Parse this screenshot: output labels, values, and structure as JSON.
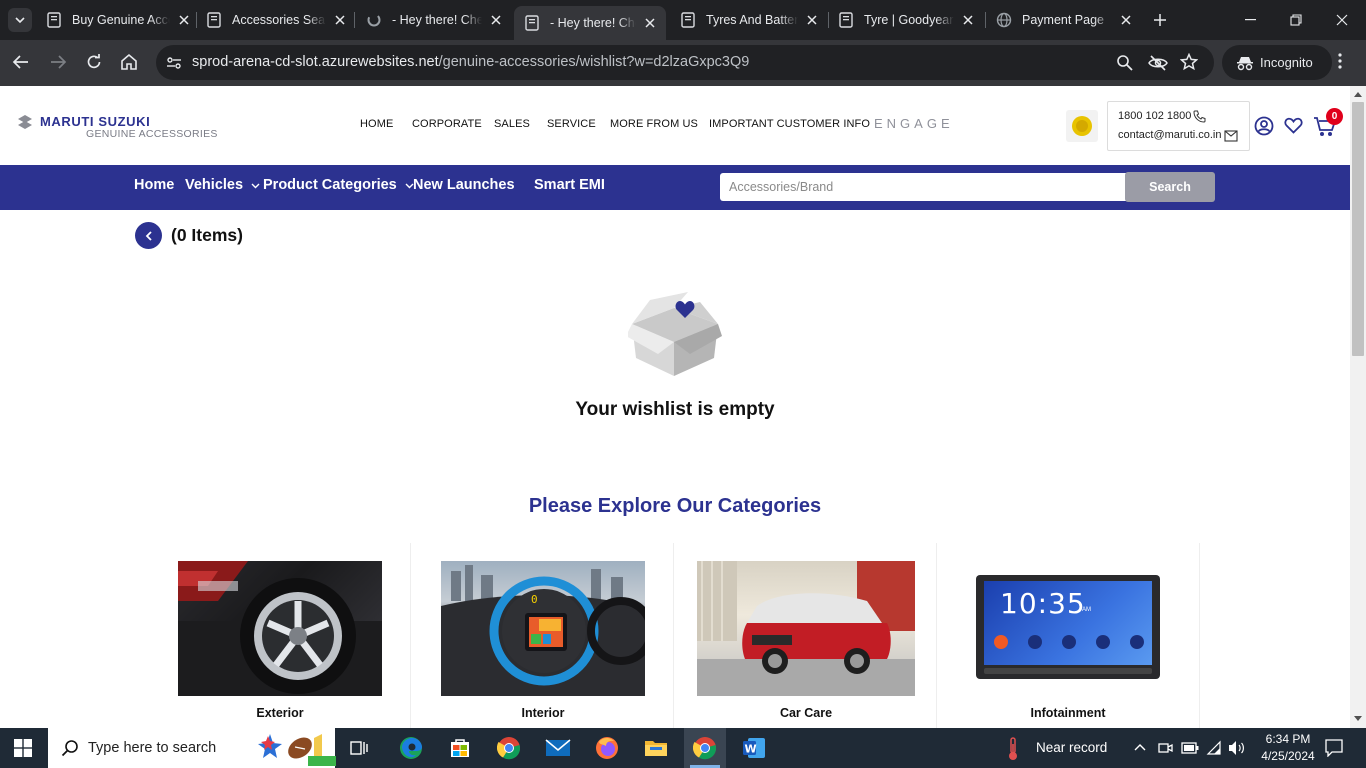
{
  "browser": {
    "tabs": [
      {
        "title": "Buy Genuine Accessories",
        "active": false
      },
      {
        "title": "Accessories Search",
        "active": false
      },
      {
        "title": "- Hey there! Check",
        "active": false
      },
      {
        "title": "- Hey there! Check",
        "active": true
      },
      {
        "title": "Tyres And Batteries",
        "active": false
      },
      {
        "title": "Tyre | Goodyear",
        "active": false
      },
      {
        "title": "Payment Page",
        "active": false
      }
    ],
    "url_host": "sprod-arena-cd-slot.azurewebsites.net",
    "url_path": "/genuine-accessories/wishlist?w=d2lzaGxpc3Q9",
    "incognito_label": "Incognito"
  },
  "header": {
    "brand": "MARUTI SUZUKI",
    "brand_sub": "GENUINE ACCESSORIES",
    "nav": [
      "HOME",
      "CORPORATE",
      "SALES",
      "SERVICE",
      "MORE FROM US",
      "IMPORTANT CUSTOMER INFO"
    ],
    "engage": "ENGAGE",
    "phone": "1800 102 1800",
    "email": "contact@maruti.co.in",
    "cart_count": "0"
  },
  "bluenav": {
    "items": [
      "Home",
      "Vehicles",
      "Product Categories",
      "New Launches",
      "Smart EMI"
    ],
    "search_placeholder": "Accessories/Brand",
    "search_button": "Search"
  },
  "wishlist": {
    "count_label": "(0 Items)",
    "empty_message": "Your wishlist is empty"
  },
  "categories": {
    "heading": "Please Explore Our Categories",
    "items": [
      "Exterior",
      "Interior",
      "Car Care",
      "Infotainment"
    ]
  },
  "infotainment_screen": {
    "clock": "10:35",
    "ampm": "AM"
  },
  "taskbar": {
    "search_placeholder": "Type here to search",
    "weather": "Near record",
    "time": "6:34 PM",
    "date": "4/25/2024"
  },
  "colors": {
    "brand_blue": "#2c3290",
    "chrome_dark": "#202124",
    "chrome_mid": "#35363a",
    "badge_red": "#e0001b"
  }
}
